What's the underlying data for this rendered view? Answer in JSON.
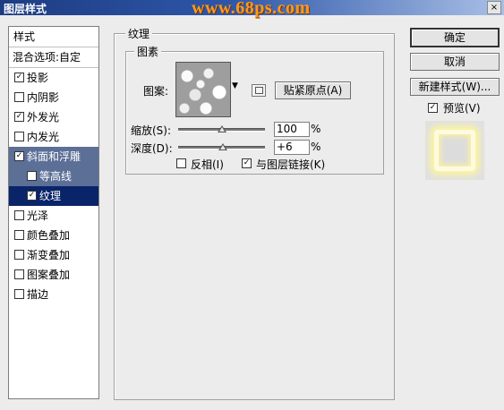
{
  "window": {
    "title": "图层样式",
    "watermark": "www.68ps.com",
    "close_glyph": "×"
  },
  "style_list": {
    "header": "样式",
    "items": [
      {
        "label": "混合选项:自定",
        "checkbox": false,
        "checked": false
      },
      {
        "label": "投影",
        "checkbox": true,
        "checked": true
      },
      {
        "label": "内阴影",
        "checkbox": true,
        "checked": false
      },
      {
        "label": "外发光",
        "checkbox": true,
        "checked": true
      },
      {
        "label": "内发光",
        "checkbox": true,
        "checked": false
      },
      {
        "label": "斜面和浮雕",
        "checkbox": true,
        "checked": true
      },
      {
        "label": "等高线",
        "checkbox": true,
        "checked": false
      },
      {
        "label": "纹理",
        "checkbox": true,
        "checked": true
      },
      {
        "label": "光泽",
        "checkbox": true,
        "checked": false
      },
      {
        "label": "颜色叠加",
        "checkbox": true,
        "checked": false
      },
      {
        "label": "渐变叠加",
        "checkbox": true,
        "checked": false
      },
      {
        "label": "图案叠加",
        "checkbox": true,
        "checked": false
      },
      {
        "label": "描边",
        "checkbox": true,
        "checked": false
      }
    ]
  },
  "texture": {
    "group_title": "纹理",
    "elements_title": "图素",
    "pattern_label": "图案:",
    "snap_button": "贴紧原点(A)",
    "scale_label": "缩放(S):",
    "scale_value": "100",
    "scale_unit": "%",
    "depth_label": "深度(D):",
    "depth_value": "+6",
    "depth_unit": "%",
    "invert_label": "反相(I)",
    "invert_checked": false,
    "link_label": "与图层链接(K)",
    "link_checked": true
  },
  "actions": {
    "ok": "确定",
    "cancel": "取消",
    "new_style": "新建样式(W)...",
    "preview_label": "预览(V)",
    "preview_checked": true
  }
}
